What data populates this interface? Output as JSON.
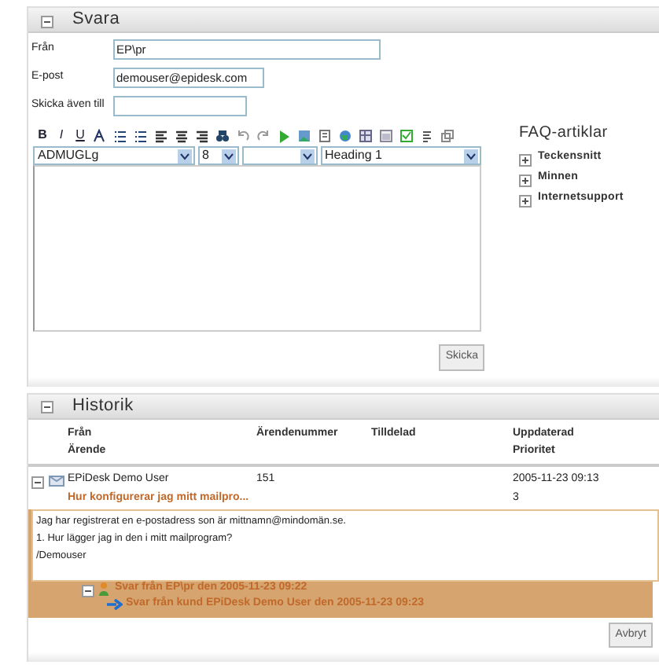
{
  "reply": {
    "title": "Svara",
    "expanded": true,
    "fields": [
      {
        "label": "Från",
        "value": "EP\\pr"
      },
      {
        "label": "E-post",
        "value": "demouser@epidesk.com"
      },
      {
        "label": "Skicka även till"
      }
    ],
    "format_buttons": [
      "B",
      "I",
      "U"
    ],
    "selects": [
      "ADMUGLg",
      "8",
      "Heading 1"
    ],
    "send_button": "Skicka",
    "faq": {
      "title": "FAQ-artiklar",
      "items": [
        {
          "label": "Teckensnitt",
          "expanded": false
        },
        {
          "label": "Minnen",
          "expanded": false
        },
        {
          "label": "Internetsupport",
          "expanded": false
        }
      ]
    }
  },
  "history": {
    "title": "Historik",
    "expanded": true,
    "columns": [
      [
        "Från",
        "Ärende"
      ],
      [
        "Ärendenummer"
      ],
      [
        "Tilldelad"
      ],
      [
        "Uppdaterad",
        "Prioritet"
      ]
    ],
    "ticket": {
      "expanded": true,
      "from": "EPiDesk Demo User",
      "number": "151",
      "updated": "2005-11-23 09:13",
      "subject": "Hur konfigurerar jag mitt mailpro...",
      "priority": "3",
      "message": [
        "Jag har registrerat en e-postadress son är mittnamn@mindomän.se.",
        "1. Hur lägger jag in den i mitt mailprogram?",
        "/Demouser"
      ],
      "replies": [
        {
          "kind": "agent",
          "text": "Svar från EP\\pr den 2005-11-23 09:22",
          "expanded": true
        },
        {
          "kind": "customer",
          "text": "Svar från kund EPiDesk Demo User den 2005-11-23 09:23"
        }
      ]
    },
    "cancel_button": "Avbryt"
  }
}
